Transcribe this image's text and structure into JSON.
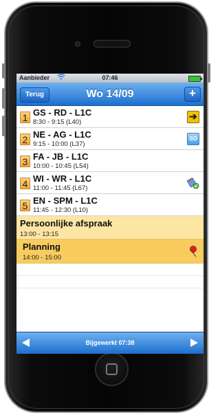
{
  "status_bar": {
    "carrier": "Aanbieder",
    "time": "07:46"
  },
  "nav": {
    "back_label": "Terug",
    "title": "Wo 14/09",
    "add_label": "+"
  },
  "lessons": [
    {
      "number": "1",
      "title": "GS - RD - L1C",
      "time": "8:30 - 9:15 (L40)",
      "icon": "arrow-right-icon"
    },
    {
      "number": "2",
      "title": "NE - AG - L1C",
      "time": "9:15 - 10:00 (L37)",
      "icon": "so-icon",
      "icon_text": "SO"
    },
    {
      "number": "3",
      "title": "FA - JB - L1C",
      "time": "10:00 - 10:45 (L54)"
    },
    {
      "number": "4",
      "title": "WI - WR - L1C",
      "time": "11:00 - 11:45 (L67)",
      "icon": "homework-done-icon"
    },
    {
      "number": "5",
      "title": "EN - SPM - L1C",
      "time": "11:45 - 12:30 (L10)"
    }
  ],
  "appointments": [
    {
      "title": "Persoonlijke afspraak",
      "time": "13:00 - 13:15"
    },
    {
      "title": "Planning",
      "time": "14:00 - 15:00",
      "icon": "pushpin-icon"
    }
  ],
  "toolbar": {
    "status": "Bijgewerkt 07:38"
  },
  "colors": {
    "nav_blue": "#1c6fd0",
    "appointment": "#fde6a3",
    "planning": "#f8cc5f",
    "badge": "#f2a83c"
  }
}
